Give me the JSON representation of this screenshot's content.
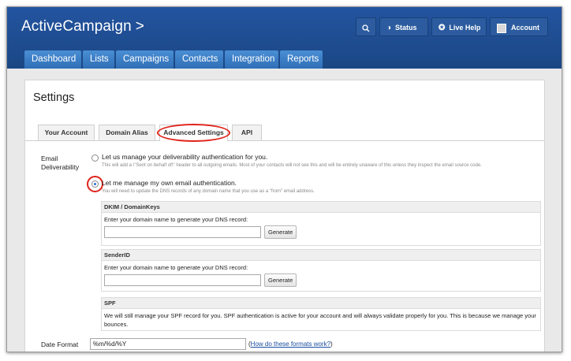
{
  "app": {
    "logo": "ActiveCampaign",
    "logo_chevron": ">"
  },
  "topbar": {
    "search_icon": "search-icon",
    "status_label": "Status",
    "help_label": "Live Help",
    "account_label": "Account"
  },
  "nav": {
    "tabs": [
      {
        "label": "Dashboard"
      },
      {
        "label": "Lists"
      },
      {
        "label": "Campaigns"
      },
      {
        "label": "Contacts"
      },
      {
        "label": "Integration"
      },
      {
        "label": "Reports"
      }
    ]
  },
  "page": {
    "title": "Settings"
  },
  "settings_tabs": [
    {
      "label": "Your Account"
    },
    {
      "label": "Domain Alias"
    },
    {
      "label": "Advanced Settings",
      "active": true
    },
    {
      "label": "API"
    }
  ],
  "email_deliverability": {
    "label_line1": "Email",
    "label_line2": "Deliverability",
    "option1": {
      "label": "Let us manage your deliverability authentication for you.",
      "desc": "This will add a \\\"Sent on behalf of\\\" header to all outgoing emails. Most of your contacts will not see this and will be entirely unaware of this unless they inspect the email source code.",
      "checked": false
    },
    "option2": {
      "label": "Let me manage my own email authentication.",
      "desc": "You will need to update the DNS records of any domain name that you use as a \"from\" email address.",
      "checked": true
    }
  },
  "dkim": {
    "header": "DKIM / DomainKeys",
    "prompt": "Enter your domain name to generate your DNS record:",
    "value": "",
    "button": "Generate"
  },
  "senderid": {
    "header": "SenderID",
    "prompt": "Enter your domain name to generate your DNS record:",
    "value": "",
    "button": "Generate"
  },
  "spf": {
    "header": "SPF",
    "text": "We will still manage your SPF record for you. SPF authentication is active for your account and will always validate properly for you. This is because we manage your bounces."
  },
  "date_format": {
    "label": "Date Format",
    "value": "%m/%d/%Y",
    "help_open": "(",
    "help_link": "How do these formats work?",
    "help_close": ")"
  },
  "colors": {
    "header": "#1e4e8c",
    "nav_tab": "#3b7dc6",
    "highlight": "#e0231b"
  }
}
